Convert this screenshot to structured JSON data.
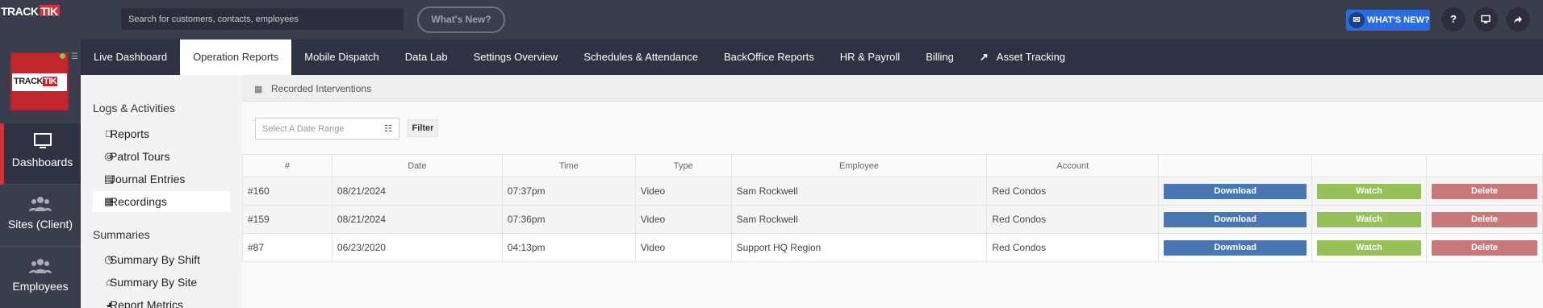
{
  "topbar": {
    "logo_a": "TRACK",
    "logo_b": "TIK",
    "search_placeholder": "Search for customers, contacts, employees",
    "whats_new_outline": "What's New?",
    "whats_new_button": "WHAT'S NEW?",
    "help_icon_glyph": "?",
    "monitor_icon": "monitor-icon",
    "share_icon": "share-icon"
  },
  "nav": {
    "items": [
      {
        "label": "Live Dashboard"
      },
      {
        "label": "Operation Reports",
        "active": true
      },
      {
        "label": "Mobile Dispatch"
      },
      {
        "label": "Data Lab"
      },
      {
        "label": "Settings Overview"
      },
      {
        "label": "Schedules & Attendance"
      },
      {
        "label": "BackOffice Reports"
      },
      {
        "label": "HR & Payroll"
      },
      {
        "label": "Billing"
      },
      {
        "label": "Asset Tracking"
      }
    ]
  },
  "leftbar": {
    "brand_a": "TRACK",
    "brand_b": "TIK",
    "tabs": [
      {
        "label": "Dashboards",
        "icon": "monitor-icon",
        "active": true
      },
      {
        "label": "Sites (Client)",
        "icon": "people-icon"
      },
      {
        "label": "Employees",
        "icon": "people-icon"
      }
    ]
  },
  "subbar": {
    "section1": "Logs & Activities",
    "items1": [
      {
        "label": "Reports",
        "icon": "document-icon"
      },
      {
        "label": "Patrol Tours",
        "icon": "target-icon"
      },
      {
        "label": "Journal Entries",
        "icon": "book-icon"
      },
      {
        "label": "Recordings",
        "icon": "film-icon",
        "active": true
      }
    ],
    "section2": "Summaries",
    "items2": [
      {
        "label": "Summary By Shift",
        "icon": "clock-icon"
      },
      {
        "label": "Summary By Site",
        "icon": "home-icon"
      },
      {
        "label": "Report Metrics",
        "icon": "pie-chart-icon"
      }
    ]
  },
  "main": {
    "section_title": "Recorded Interventions",
    "date_placeholder": "Select A Date Range",
    "filter_label": "Filter",
    "columns": [
      "#",
      "Date",
      "Time",
      "Type",
      "Employee",
      "Account",
      "",
      "",
      ""
    ],
    "rows": [
      {
        "id": "#160",
        "date": "08/21/2024",
        "time": "07:37pm",
        "type": "Video",
        "employee": "Sam Rockwell",
        "account": "Red Condos"
      },
      {
        "id": "#159",
        "date": "08/21/2024",
        "time": "07:36pm",
        "type": "Video",
        "employee": "Sam Rockwell",
        "account": "Red Condos"
      },
      {
        "id": "#87",
        "date": "06/23/2020",
        "time": "04:13pm",
        "type": "Video",
        "employee": "Support HQ Region",
        "account": "Red Condos"
      }
    ],
    "download_label": "Download",
    "watch_label": "Watch",
    "delete_label": "Delete"
  },
  "colors": {
    "topbar": "#3a3d4c",
    "nav": "#2f3242",
    "accent_red": "#d3323f",
    "download": "#4a76b1",
    "watch": "#96c15a",
    "delete": "#c77979",
    "whats_new": "#2b6de0"
  }
}
